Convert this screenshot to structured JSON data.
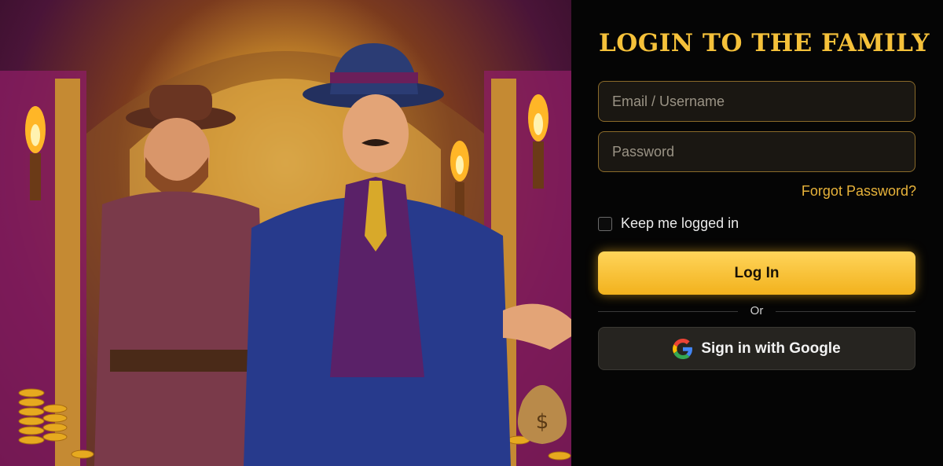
{
  "login": {
    "title": "LOGIN TO THE FAMILY",
    "email_placeholder": "Email / Username",
    "password_placeholder": "Password",
    "forgot_password": "Forgot Password?",
    "keep_logged_in": "Keep me logged in",
    "login_button": "Log In",
    "divider": "Or",
    "google_button": "Sign in with Google"
  },
  "colors": {
    "accent": "#f5c13a",
    "panel_bg": "#050505",
    "field_border": "#8a6a2a",
    "button_gold": "#f2b21d"
  },
  "icons": [
    "google-icon"
  ]
}
